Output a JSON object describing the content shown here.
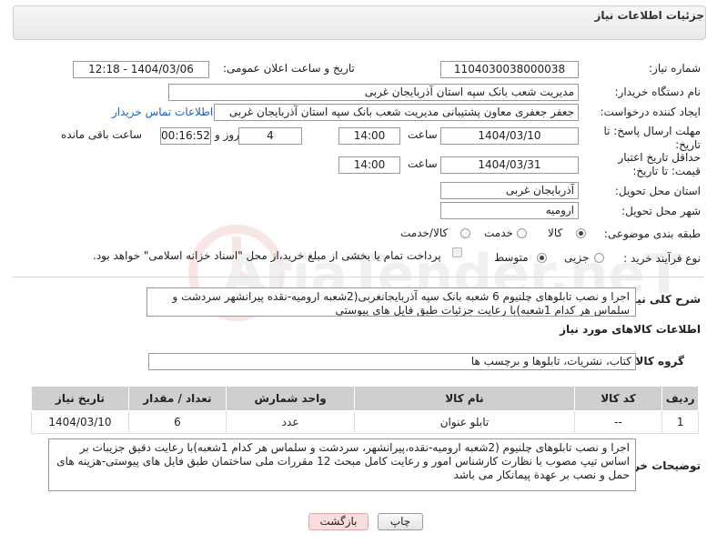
{
  "panel": {
    "title": "جزئیات اطلاعات نیاز"
  },
  "fields": {
    "need_number_label": "شماره نیاز:",
    "need_number": "1104030038000038",
    "announce_label": "تاریخ و ساعت اعلان عمومی:",
    "announce_value": "1404/03/06 - 12:18",
    "buyer_org_label": "نام دستگاه خریدار:",
    "buyer_org": "مدیریت شعب بانک سپه استان آذربایجان غربی",
    "requester_label": "ایجاد کننده درخواست:",
    "requester": "جعفر جعفری معاون پشتیبانی مدیریت شعب بانک سپه استان آذربایجان غربی",
    "contact_link": "اطلاعات تماس خریدار",
    "reply_deadline_label": "مهلت ارسال پاسخ: تا تاریخ:",
    "reply_date": "1404/03/10",
    "time_label": "ساعت",
    "reply_time": "14:00",
    "days_value": "4",
    "days_label": "روز و",
    "remaining_time": "00:16:52",
    "remaining_label": "ساعت باقی مانده",
    "price_validity_label": "حداقل تاریخ اعتبار قیمت: تا تاریخ:",
    "validity_date": "1404/03/31",
    "validity_time": "14:00",
    "province_label": "استان محل تحویل:",
    "province": "آذربایجان غربی",
    "city_label": "شهر محل تحویل:",
    "city": "ارومیه",
    "category_label": "طبقه بندی موضوعی:",
    "category_options": [
      "کالا",
      "خدمت",
      "کالا/خدمت"
    ],
    "process_label": "نوع فرآیند خرید :",
    "process_options": [
      "جزیی",
      "متوسط"
    ],
    "payment_note": "پرداخت تمام یا بخشی از مبلغ خرید،از محل \"اسناد خزانه اسلامی\" خواهد بود.",
    "description_label": "شرح کلی نیاز:",
    "description": "اجرا و نصب تابلوهای چلنیوم 6 شعبه بانک سپه آذربایجانغربی(2شعبه ارومیه-نقده پیرانشهر سردشت و سلماس هر کدام 1شعبه)با رعایت جزئیات طبق فایل های پیوستی"
  },
  "goods": {
    "section_title": "اطلاعات کالاهای مورد نیاز",
    "group_label": "گروه کالا:",
    "group_value": "کتاب، نشریات، تابلوها و برچسب ها",
    "headers": [
      "ردیف",
      "کد کالا",
      "نام کالا",
      "واحد شمارش",
      "تعداد / مقدار",
      "تاریخ نیاز"
    ],
    "rows": [
      {
        "index": "1",
        "code": "--",
        "name": "تابلو عنوان",
        "unit": "عدد",
        "qty": "6",
        "date": "1404/03/10"
      }
    ]
  },
  "buyer_notes": {
    "label": "توضیحات خریدار:",
    "text": "اجرا و نصب تابلوهای چلنیوم (2شعبه ارومیه-نقده،پیرانشهر، سردشت و سلماس هر کدام 1شعبه)با رعایت دقیق جزیبات بر اساس تیپ مصوب با نظارت کارشناس امور و رعایت کامل مبحث 12 مقررات ملی ساختمان طبق فایل های پیوستی-هزینه های حمل و نصب بر عهدة پیمانکار می باشد"
  },
  "buttons": {
    "print": "چاپ",
    "back": "بازگشت"
  },
  "watermark": {
    "text": "AriaTender.neT"
  },
  "colors": {
    "link": "#1e63b8",
    "back_button": "#f9dede",
    "header_bg": "#cfcfcf"
  }
}
